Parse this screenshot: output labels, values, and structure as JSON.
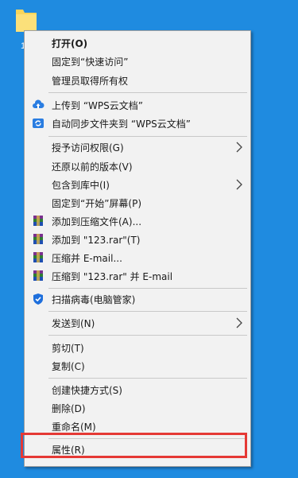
{
  "desktop": {
    "folder_label": "12"
  },
  "menu": {
    "items": [
      {
        "label": "打开(O)"
      },
      {
        "label": "固定到“快速访问”"
      },
      {
        "label": "管理员取得所有权"
      },
      {
        "label": "上传到 “WPS云文档”",
        "icon": "cloud-upload-icon"
      },
      {
        "label": "自动同步文件夹到 “WPS云文档”",
        "icon": "sync-folder-icon"
      },
      {
        "label": "授予访问权限(G)",
        "submenu": true
      },
      {
        "label": "还原以前的版本(V)"
      },
      {
        "label": "包含到库中(I)",
        "submenu": true
      },
      {
        "label": "固定到“开始”屏幕(P)"
      },
      {
        "label": "添加到压缩文件(A)...",
        "icon": "winrar-icon"
      },
      {
        "label": "添加到 \"123.rar\"(T)",
        "icon": "winrar-icon"
      },
      {
        "label": "压缩并 E-mail...",
        "icon": "winrar-icon"
      },
      {
        "label": "压缩到 \"123.rar\" 并 E-mail",
        "icon": "winrar-icon"
      },
      {
        "label": "扫描病毒(电脑管家)",
        "icon": "shield-icon"
      },
      {
        "label": "发送到(N)",
        "submenu": true
      },
      {
        "label": "剪切(T)"
      },
      {
        "label": "复制(C)"
      },
      {
        "label": "创建快捷方式(S)"
      },
      {
        "label": "删除(D)"
      },
      {
        "label": "重命名(M)"
      },
      {
        "label": "属性(R)"
      }
    ]
  },
  "colors": {
    "desktop_bg": "#1f8be0",
    "menu_bg": "#f2f2f2",
    "highlight_border": "#e53935"
  }
}
